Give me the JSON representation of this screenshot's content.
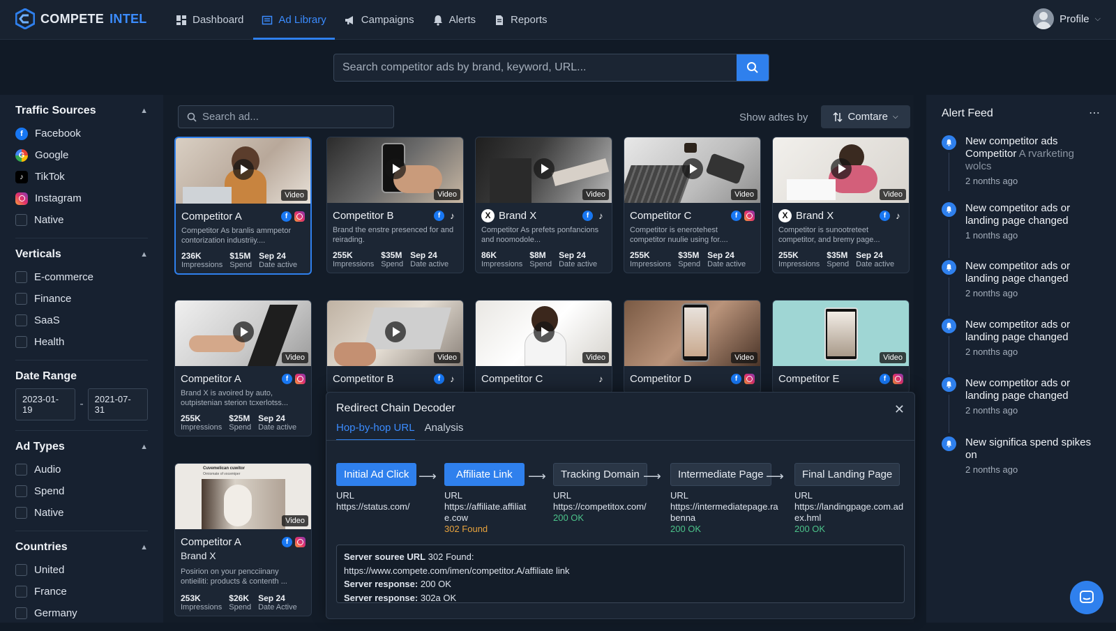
{
  "app": {
    "name_part1": "COMPETE",
    "name_part2": "INTEL"
  },
  "nav": [
    {
      "label": "Dashboard",
      "icon": "dashboard-icon",
      "active": false
    },
    {
      "label": "Ad Library",
      "icon": "library-icon",
      "active": true
    },
    {
      "label": "Campaigns",
      "icon": "megaphone-icon",
      "active": false
    },
    {
      "label": "Alerts",
      "icon": "bell-icon",
      "active": false
    },
    {
      "label": "Reports",
      "icon": "document-icon",
      "active": false
    }
  ],
  "profile": {
    "label": "Profile"
  },
  "search": {
    "placeholder": "Search competitor ads by brand, keyword, URL..."
  },
  "sidebar": {
    "traffic": {
      "title": "Traffic Sources",
      "items": [
        "Facebook",
        "Google",
        "TikTok",
        "Instagram",
        "Native"
      ]
    },
    "verticals": {
      "title": "Verticals",
      "items": [
        "E-commerce",
        "Finance",
        "SaaS",
        "Health"
      ]
    },
    "date": {
      "title": "Date Range",
      "from": "2023-01-19",
      "sep": "-",
      "to": "2021-07-31"
    },
    "adtypes": {
      "title": "Ad Types",
      "items": [
        "Audio",
        "Spend",
        "Native"
      ]
    },
    "countries": {
      "title": "Countries",
      "items": [
        "United",
        "France",
        "Germany"
      ]
    }
  },
  "main": {
    "ad_search_placeholder": "Search ad...",
    "sort_label": "Show adtes by",
    "sort_value": "Comtare"
  },
  "cards": [
    {
      "title": "Competitor A",
      "desc": "Competitor As branlis ammpetor contorization industriiy....",
      "impr": "236K",
      "spend": "$15M",
      "date": "Sep 24",
      "badge": "Video",
      "impr_label": "Impressions",
      "spend_label": "Spend",
      "date_label": "Date active"
    },
    {
      "title": "Competitor B",
      "desc": "Brand the enstre presenced for and reirading.",
      "impr": "255K",
      "spend": "$35M",
      "date": "Sep 24",
      "badge": "Video",
      "impr_label": "Impressions",
      "spend_label": "Spend",
      "date_label": "Date active"
    },
    {
      "title": "Brand X",
      "desc": "Competitor As prefets ponfancions and noomodole...",
      "impr": "86K",
      "spend": "$8M",
      "date": "Sep 24",
      "badge": "Video",
      "impr_label": "Impressions",
      "spend_label": "Spend",
      "date_label": "Date active"
    },
    {
      "title": "Competitor C",
      "desc": "Competitor is enerotehest competitor nuulie using for....",
      "impr": "255K",
      "spend": "$35M",
      "date": "Sep 24",
      "badge": "Video",
      "impr_label": "Impressions",
      "spend_label": "Spend",
      "date_label": "Date active"
    },
    {
      "title": "Brand X",
      "desc": "Competitor is sunootreteet competitor, and bremy page...",
      "impr": "255K",
      "spend": "$35M",
      "date": "Sep 24",
      "badge": "Video",
      "impr_label": "Impressions",
      "spend_label": "Spend",
      "date_label": "Date active"
    },
    {
      "title": "Competitor A",
      "desc": "Brand X is avoired by auto, outpistenian sterion tcxerlotss...",
      "impr": "255K",
      "spend": "$25M",
      "date": "Sep 24",
      "badge": "Video",
      "impr_label": "Impressions",
      "spend_label": "Spend",
      "date_label": "Date active"
    },
    {
      "title": "Competitor B",
      "badge": "Video"
    },
    {
      "title": "Competitor C",
      "badge": "Video"
    },
    {
      "title": "Competitor D",
      "badge": "Video"
    },
    {
      "title": "Competitor E",
      "badge": "Video"
    },
    {
      "title": "Competitor A",
      "sub": "Brand X",
      "desc": "Posirion on your pencciinany ontieiliti: products & contenth ...",
      "impr": "253K",
      "spend": "$26K",
      "date": "Sep 24",
      "badge": "Video",
      "impr_label": "Impressions",
      "spend_label": "Spend",
      "date_label": "Date Active",
      "thumb_title": "Cuvemelican cuwitor",
      "thumb_sub": "Orniomate of vocemiper"
    }
  ],
  "modal": {
    "title": "Redirect Chain Decoder",
    "tabs": [
      "Hop-by-hop URL",
      "Analysis"
    ],
    "url_label": "URL",
    "hops": [
      {
        "label": "Initial Ad Click",
        "url": "https://status.com/",
        "status": ""
      },
      {
        "label": "Affiliate Link",
        "url": "https://affiliate.affiliate.cow",
        "status": "302 Found"
      },
      {
        "label": "Tracking Domain",
        "url": "https://competitox.com/",
        "status": "200 OK"
      },
      {
        "label": "Intermediate Page",
        "url": "https://intermediatepage.rabenna",
        "status": "200 OK"
      },
      {
        "label": "Final Landing Page",
        "url": "https://landingpage.com.adex.hml",
        "status": "200 OK"
      }
    ],
    "server": {
      "l1_bold": "Server souree URL",
      "l1_rest": " 302 Found:",
      "l2": "https://www.compete.com/imen/competitor.A/affiliate link",
      "l3_bold": "Server response:",
      "l3_rest": " 200 OK",
      "l4_bold": "Server response:",
      "l4_rest": " 302a OK"
    }
  },
  "alert_feed": {
    "title": "Alert Feed",
    "items": [
      {
        "title": "New competitor ads Competitor ",
        "muted": "A rvarketing wolcs",
        "time": "2 nonths ago"
      },
      {
        "title": "New competitor ads or landing page changed",
        "muted": "",
        "time": "1 nonths ago"
      },
      {
        "title": "New competitor ads or landing page changed",
        "muted": "",
        "time": "2 nonths ago"
      },
      {
        "title": "New competitor ads or landing page changed",
        "muted": "",
        "time": "2 nonths ago"
      },
      {
        "title": "New competitor ads or landing page changed",
        "muted": "",
        "time": "2 nonths ago"
      },
      {
        "title": "New significa spend spikes on",
        "muted": "",
        "time": "2 nonths ago"
      }
    ]
  },
  "colors": {
    "accent": "#2f80ed",
    "ok": "#4cc38a",
    "warning": "#e8a33d"
  }
}
